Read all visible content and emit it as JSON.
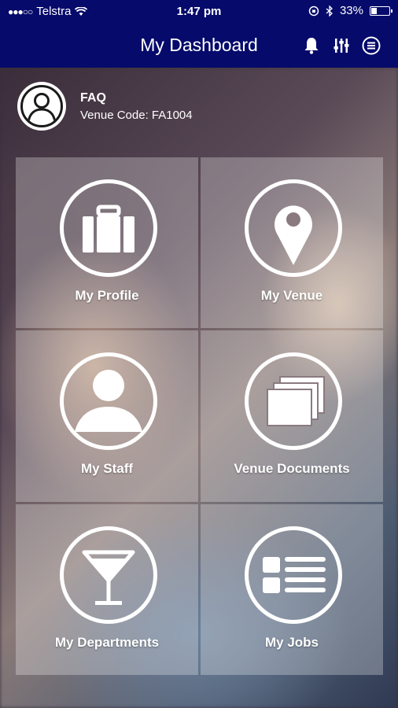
{
  "status_bar": {
    "signal": "●●●○○",
    "carrier": "Telstra",
    "time": "1:47 pm",
    "battery": "33%",
    "battery_level": 0.33
  },
  "header": {
    "title": "My Dashboard",
    "icons": [
      "bell-icon",
      "sliders-icon",
      "list-circle-icon"
    ]
  },
  "user": {
    "name": "FAQ",
    "venue_code": "Venue Code: FA1004"
  },
  "tiles": [
    {
      "label": "My Profile",
      "icon": "briefcase-icon"
    },
    {
      "label": "My Venue",
      "icon": "map-pin-icon"
    },
    {
      "label": "My Staff",
      "icon": "person-icon"
    },
    {
      "label": "Venue Documents",
      "icon": "documents-icon"
    },
    {
      "label": "My Departments",
      "icon": "cocktail-glass-icon"
    },
    {
      "label": "My Jobs",
      "icon": "list-icon"
    }
  ],
  "colors": {
    "header_bg": "#050a6b",
    "tile_bg": "rgba(255,255,255,0.28)"
  }
}
